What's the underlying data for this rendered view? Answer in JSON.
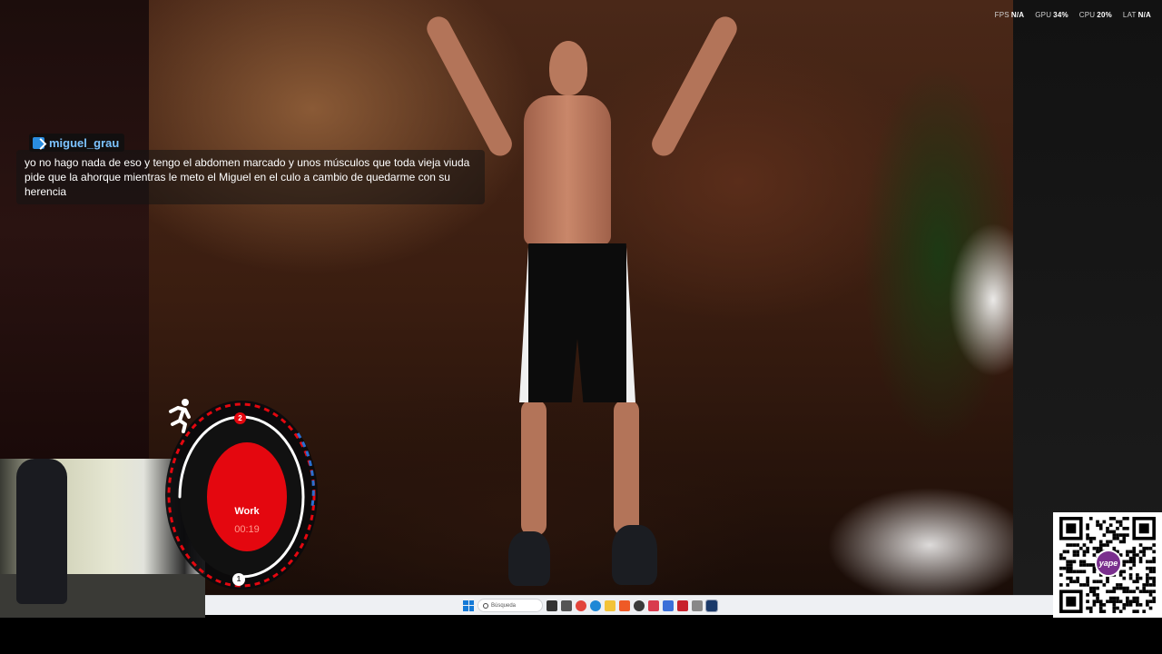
{
  "overlay_stats": {
    "fps_label": "FPS",
    "fps_value": "N/A",
    "gpu_label": "GPU",
    "gpu_value": "34%",
    "cpu_label": "CPU",
    "cpu_value": "20%",
    "lat_label": "LAT",
    "lat_value": "N/A"
  },
  "chat": {
    "username": "miguel_grau",
    "message": "yo no hago nada de eso y tengo el abdomen marcado y unos músculos que toda vieja viuda pide que la ahorque mientras le meto el Miguel en el culo a cambio de quedarme con su herencia",
    "username_color": "#7cc3ff",
    "badge_color": "#2a8de0"
  },
  "workout_timer": {
    "label": "Work",
    "time": "00:19",
    "top_counter": "2",
    "bottom_counter": "1",
    "progress_fraction": 0.75,
    "accent_color": "#e4070f",
    "icon": "running-person-icon"
  },
  "taskbar": {
    "start_icon": "windows-start-icon",
    "search_placeholder": "Búsqueda",
    "apps": [
      {
        "icon": "task-view-icon",
        "color": "#333333"
      },
      {
        "icon": "cube-app-icon",
        "color": "#555555"
      },
      {
        "icon": "chrome-icon",
        "color": "#e2453c"
      },
      {
        "icon": "edge-icon",
        "color": "#1e88d6"
      },
      {
        "icon": "file-explorer-icon",
        "color": "#f3c338"
      },
      {
        "icon": "brave-icon",
        "color": "#ef5a26"
      },
      {
        "icon": "obs-icon",
        "color": "#3a3a3a"
      },
      {
        "icon": "discord-icon",
        "color": "#d93b4d"
      },
      {
        "icon": "app-blue-icon",
        "color": "#3b6fd8"
      },
      {
        "icon": "app-red-icon",
        "color": "#c8222c"
      },
      {
        "icon": "app-gray-icon",
        "color": "#888888"
      },
      {
        "icon": "steam-icon",
        "color": "#1b3a6a"
      }
    ]
  },
  "qr": {
    "badge_text": "yape",
    "badge_color": "#7a2f8e"
  }
}
